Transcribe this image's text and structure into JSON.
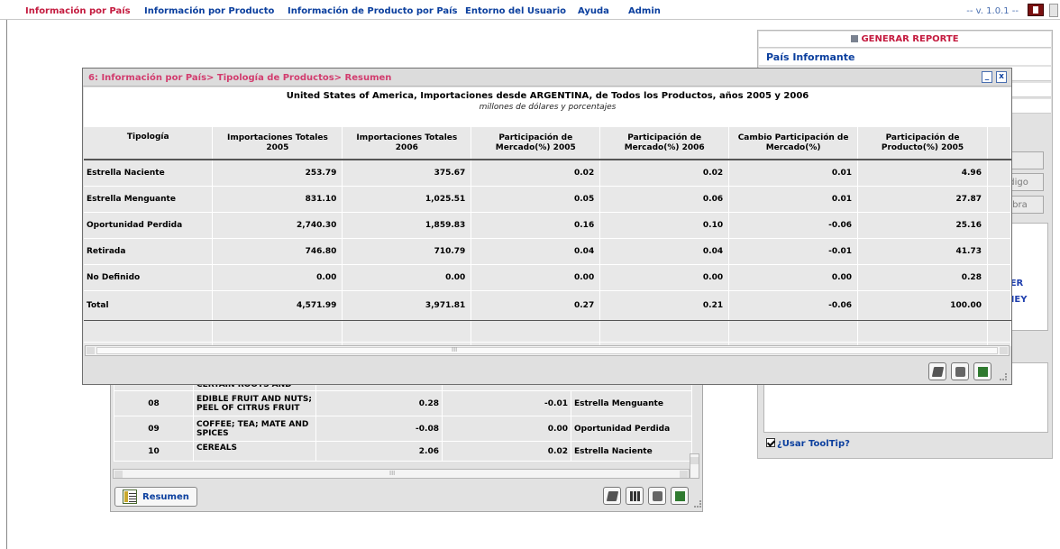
{
  "nav": {
    "items": [
      "Información por País",
      "Información por Producto",
      "Información de Producto por País",
      "Entorno del Usuario",
      "Ayuda",
      "Admin"
    ],
    "version": "-- v. 1.0.1 --"
  },
  "right_panel": {
    "generar_label": "GENERAR REPORTE",
    "pais_label": "País Informante",
    "btn_codigo": "ódigo",
    "btn_palabra": "labra",
    "link_1": "IER",
    "link_2": "NEY",
    "tooltip_label": "¿Usar ToolTip?"
  },
  "modal": {
    "title": "6: Información por País> Tipología de Productos> Resumen",
    "heading": "United States of America, Importaciones desde ARGENTINA, de Todos los Productos, años 2005 y 2006",
    "subheading": "millones de dólares y porcentajes",
    "minimize": "_",
    "close": "x",
    "scroll_mark": "III",
    "columns": [
      "Tipología",
      "Importaciones Totales 2005",
      "Importaciones Totales 2006",
      "Participación de Mercado(%) 2005",
      "Participación de Mercado(%) 2006",
      "Cambio Participación de Mercado(%)",
      "Participación de Producto(%) 2005"
    ],
    "rows": [
      [
        "Estrella Naciente",
        "253.79",
        "375.67",
        "0.02",
        "0.02",
        "0.01",
        "4.96"
      ],
      [
        "Estrella Menguante",
        "831.10",
        "1,025.51",
        "0.05",
        "0.06",
        "0.01",
        "27.87"
      ],
      [
        "Oportunidad Perdida",
        "2,740.30",
        "1,859.83",
        "0.16",
        "0.10",
        "-0.06",
        "25.16"
      ],
      [
        "Retirada",
        "746.80",
        "710.79",
        "0.04",
        "0.04",
        "-0.01",
        "41.73"
      ],
      [
        "No Definido",
        "0.00",
        "0.00",
        "0.00",
        "0.00",
        "0.00",
        "0.28"
      ],
      [
        "Total",
        "4,571.99",
        "3,971.81",
        "0.27",
        "0.21",
        "-0.06",
        "100.00"
      ]
    ]
  },
  "background_table": {
    "rows": [
      [
        "",
        "CERTAIN ROOTS AND",
        "",
        ""
      ],
      [
        "08",
        "EDIBLE FRUIT AND NUTS; PEEL OF CITRUS FRUIT",
        "0.28",
        "-0.01",
        "Estrella Menguante"
      ],
      [
        "09",
        "COFFEE; TEA; MATE AND SPICES",
        "-0.08",
        "0.00",
        "Oportunidad Perdida"
      ],
      [
        "10",
        "CEREALS",
        "2.06",
        "0.02",
        "Estrella Naciente"
      ]
    ],
    "scroll_mark": "III",
    "resumen_label": "Resumen"
  }
}
